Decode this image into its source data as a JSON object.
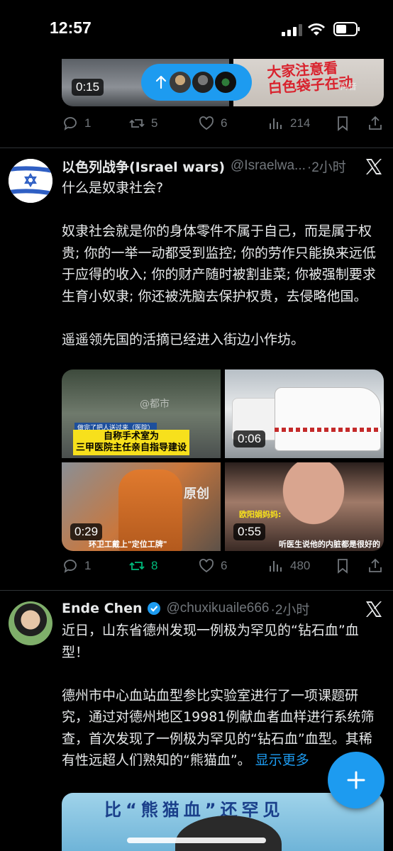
{
  "status_bar": {
    "time": "12:57"
  },
  "top_tweet": {
    "media": [
      {
        "duration": "0:15"
      },
      {
        "overlay_text": "大家注意看\n白色袋子在动",
        "watermark": "抖音"
      }
    ],
    "actions": {
      "replies": "1",
      "reposts": "5",
      "likes": "6",
      "views": "214"
    }
  },
  "new_posts_pill": {
    "icon": "arrow-up-icon"
  },
  "tweets": [
    {
      "name": "以色列战争(Israel wars)",
      "handle": "@Israelwa...",
      "time": "·2小时",
      "text": [
        "什么是奴隶社会?",
        "",
        "奴隶社会就是你的身体零件不属于自己，而是属于权贵; 你的一举一动都受到监控; 你的劳作只能换来远低于应得的收入; 你的财产随时被割韭菜; 你被强制要求生育小奴隶; 你还被洗脑去保护权贵，去侵略他国。",
        "",
        "遥遥领先国的活摘已经进入街边小作坊。"
      ],
      "media": [
        {
          "caption_small": "做完了把人送过来（医院）",
          "caption": "自称手术室为\n三甲医院主任亲自指导建设",
          "watermark": "@都市",
          "duration": ""
        },
        {
          "duration": "0:06"
        },
        {
          "duration": "0:29",
          "watermark": "原创",
          "caption": "环卫工戴上\"定位工牌\""
        },
        {
          "duration": "0:55",
          "caption": "听医生说他的内脏都是很好的",
          "label": "欧阳娟妈妈:"
        }
      ],
      "actions": {
        "replies": "1",
        "reposts": "8",
        "likes": "6",
        "views": "480"
      }
    },
    {
      "name": "Ende Chen",
      "verified": true,
      "handle": "@chuxikuaile666",
      "time": "·2小时",
      "text_main": "近日，山东省德州发现一例极为罕见的“钻石血”血型！",
      "text_body": "德州市中心血站血型参比实验室进行了一项课题研究，通过对德州地区19981例献血者血样进行系统筛查，首次发现了一例极为罕见的“钻石血”血型。其稀有性远超人们熟知的“熊猫血”。",
      "show_more": "显示更多",
      "media_text": "比“熊猫血”还罕见"
    }
  ],
  "colors": {
    "accent": "#1d9bf0",
    "repost_active": "#00ba7c",
    "muted": "#71767b",
    "background": "#000000"
  }
}
